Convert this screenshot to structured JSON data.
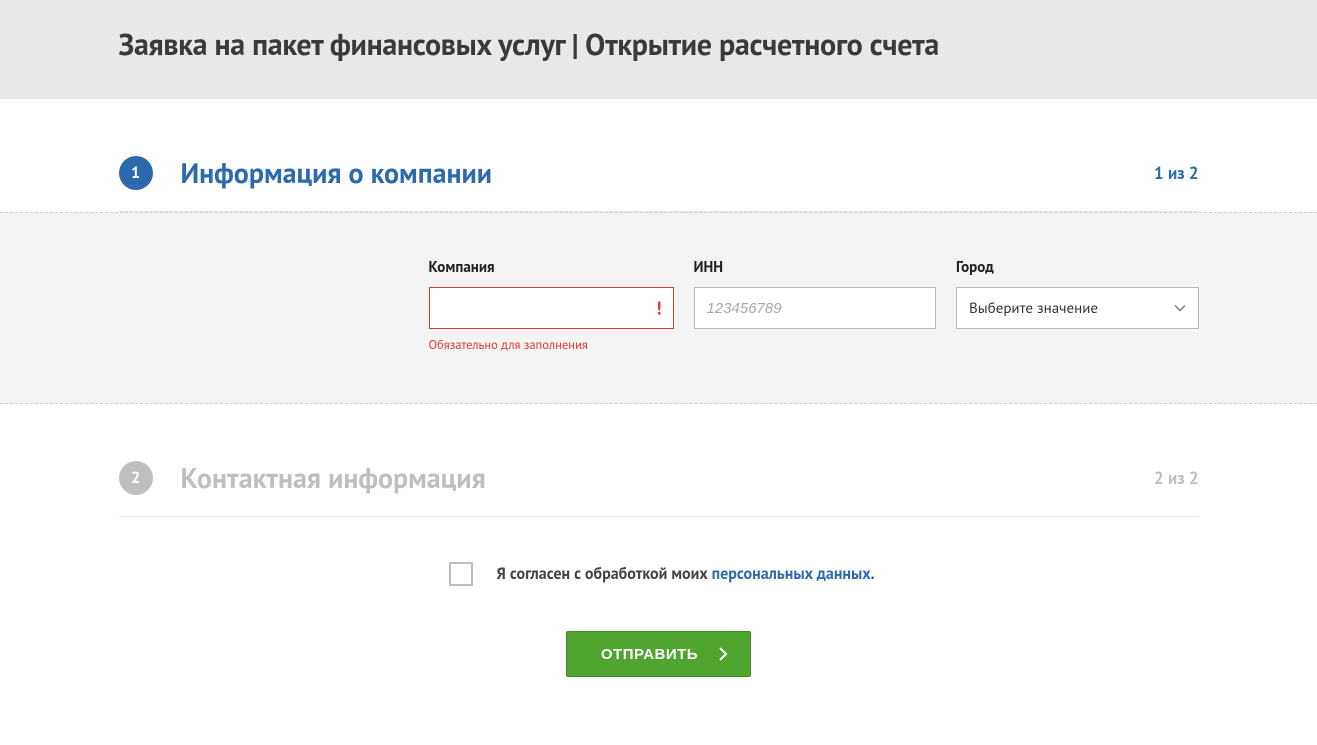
{
  "header": {
    "title": "Заявка на пакет финансовых услуг | Открытие расчетного счета"
  },
  "steps": {
    "s1": {
      "badge": "1",
      "title": "Информация о компании",
      "counter": "1 из 2"
    },
    "s2": {
      "badge": "2",
      "title": "Контактная информация",
      "counter": "2 из 2"
    }
  },
  "form": {
    "company": {
      "label": "Компания",
      "value": "",
      "error_mark": "!",
      "error_text": "Обязательно для заполнения"
    },
    "inn": {
      "label": "ИНН",
      "placeholder": "123456789",
      "value": ""
    },
    "city": {
      "label": "Город",
      "selected": "Выберите значение"
    }
  },
  "consent": {
    "text_prefix": "Я согласен с обработкой моих ",
    "link_text": "персональных данных",
    "text_suffix": "."
  },
  "actions": {
    "submit_label": "ОТПРАВИТЬ"
  }
}
